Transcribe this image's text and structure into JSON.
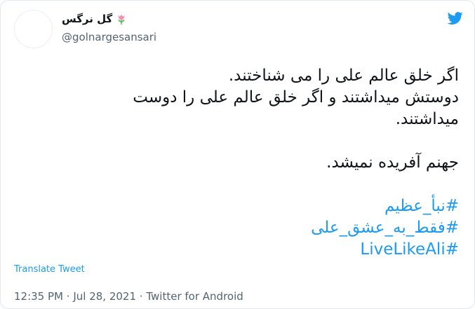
{
  "author": {
    "display_name": "گل نرگس",
    "flower_icon": "tulip-icon",
    "handle": "@golnargesansari"
  },
  "tweet": {
    "lines": [
      "اگر خلق عالم علی را می شناختند.",
      "دوستش میداشتند و اگر خلق عالم علی را دوست",
      "میداشتند."
    ],
    "line4": "جهنم آفریده نمیشد.",
    "hashtags": [
      "#نبأ_عظیم",
      "#فقط_به_عشق_علی",
      "#LiveLikeAli"
    ]
  },
  "translate_label": "Translate Tweet",
  "meta": {
    "time": "12:35 PM",
    "date": "Jul 28, 2021",
    "source": "Twitter for Android",
    "separator": "·"
  },
  "colors": {
    "link": "#1d9bf0",
    "secondary_text": "#536471",
    "border": "#e1e8ed"
  }
}
